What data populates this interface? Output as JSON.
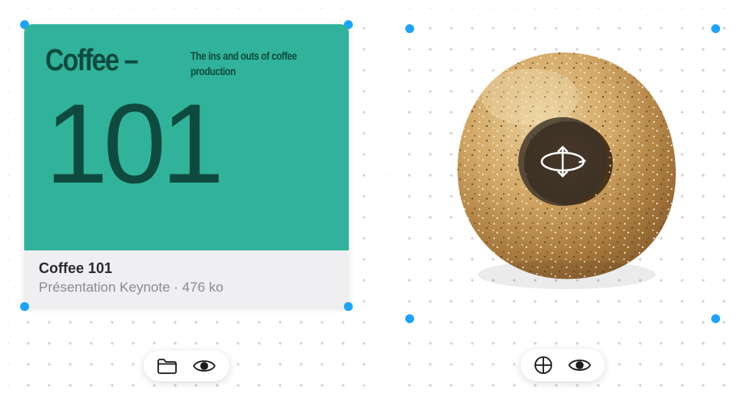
{
  "left": {
    "slide": {
      "title": "Coffee –",
      "subtitle": "The ins and outs of coffee production",
      "big_number": "101"
    },
    "meta": {
      "filename": "Coffee 101",
      "type_and_size": "Présentation Keynote · 476 ko"
    },
    "toolbar": {
      "icons": [
        "folder-icon",
        "eye-icon"
      ]
    }
  },
  "right": {
    "object": "bagel-3d-model",
    "overlay": "rotate-3d-icon",
    "toolbar": {
      "icons": [
        "globe-icon",
        "eye-icon"
      ]
    }
  },
  "colors": {
    "slide_bg": "#30b39a",
    "slide_fg": "#0f4a3f",
    "handle": "#1ba3ff",
    "meta_bg": "#efeff1"
  }
}
